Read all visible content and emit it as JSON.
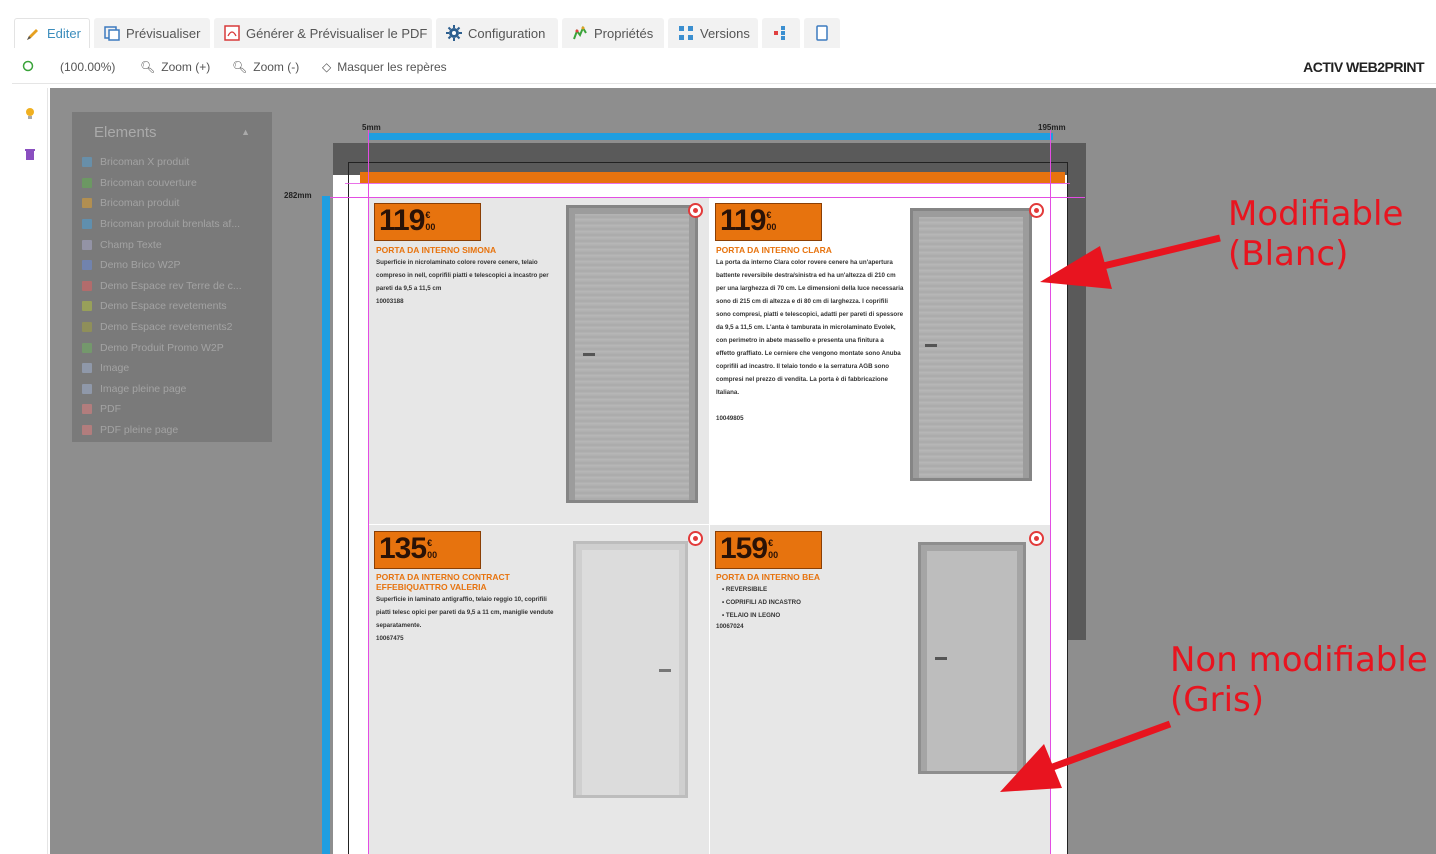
{
  "tabs": [
    {
      "label": "Editer",
      "icon": "pencil-icon",
      "active": true
    },
    {
      "label": "Prévisualiser",
      "icon": "preview-icon"
    },
    {
      "label": "Générer & Prévisualiser le PDF",
      "icon": "pdf-icon"
    },
    {
      "label": "Configuration",
      "icon": "gear-icon"
    },
    {
      "label": "Propriétés",
      "icon": "properties-icon"
    },
    {
      "label": "Versions",
      "icon": "versions-icon"
    },
    {
      "label": "",
      "icon": "layout-icon"
    },
    {
      "label": "",
      "icon": "page-icon"
    }
  ],
  "toolbar": {
    "zoom_level": "(100.00%)",
    "zoom_in": "Zoom (+)",
    "zoom_out": "Zoom (-)",
    "hide_guides": "Masquer les repères",
    "brand": "ACTIV WEB2PRINT"
  },
  "elements_panel": {
    "title": "Elements",
    "items": [
      {
        "label": "Bricoman X produit",
        "color": "#5aa0d0"
      },
      {
        "label": "Bricoman couverture",
        "color": "#60b050"
      },
      {
        "label": "Bricoman produit",
        "color": "#e0a030"
      },
      {
        "label": "Bricoman produit brenlats af...",
        "color": "#4aa0d8"
      },
      {
        "label": "Champ Texte",
        "color": "#a8a8c8"
      },
      {
        "label": "Demo Brico W2P",
        "color": "#6a8ad8"
      },
      {
        "label": "Demo Espace rev Terre de c...",
        "color": "#e06060"
      },
      {
        "label": "Demo Espace revetements",
        "color": "#b0c040"
      },
      {
        "label": "Demo Espace revetements2",
        "color": "#a0a040"
      },
      {
        "label": "Demo Produit Promo W2P",
        "color": "#70b060"
      },
      {
        "label": "Image",
        "color": "#a0b0d0"
      },
      {
        "label": "Image pleine page",
        "color": "#a0b0d0"
      },
      {
        "label": "PDF",
        "color": "#e08080"
      },
      {
        "label": "PDF pleine page",
        "color": "#e08080"
      }
    ]
  },
  "rulers": {
    "top_start": "5mm",
    "top_end": "195mm",
    "left": "282mm"
  },
  "products": [
    {
      "price_main": "119",
      "price_currency": "€",
      "price_cents": "00",
      "title": "PORTA DA INTERNO SIMONA",
      "desc": "Superficie in nicrolaminato colore rovere cenere, telaio compreso in nell, coprifili piatti e telescopici a incastro per pareti da 9,5 a 11,5 cm",
      "ref": "10003188"
    },
    {
      "price_main": "119",
      "price_currency": "€",
      "price_cents": "00",
      "title": "PORTA DA INTERNO CLARA",
      "desc": "La porta da interno Clara color rovere cenere ha un'apertura battente reversibile destra/sinistra ed ha un'altezza di 210 cm per una larghezza di 70 cm. Le dimensioni della luce necessaria sono di 215 cm di altezza e di 80 cm di larghezza. I coprifili sono compresi, piatti e telescopici, adatti per pareti di spessore da 9,5 a 11,5 cm. L'anta è tamburata in microlaminato Evolek, con perimetro in abete massello e presenta una finitura a effetto graffiato. Le cerniere che vengono montate sono Anuba coprifili ad incastro. Il telaio tondo e la serratura AGB sono compresi nel prezzo di vendita. La porta è di fabbricazione Italiana.",
      "ref": "10049805"
    },
    {
      "price_main": "135",
      "price_currency": "€",
      "price_cents": "00",
      "title": "PORTA DA INTERNO CONTRACT EFFEBIQUATTRO VALERIA",
      "desc": "Superficie in laminato antigraffio, telaio reggio 10, coprifili piatti telesc opici per pareti da 9,5 a 11 cm, maniglie vendute separatamente.",
      "ref": "10067475"
    },
    {
      "price_main": "159",
      "price_currency": "€",
      "price_cents": "00",
      "title": "PORTA DA INTERNO BEA",
      "bullets": [
        "REVERSIBILE",
        "COPRIFILI AD INCASTRO",
        "TELAIO IN LEGNO"
      ],
      "ref": "10067024"
    }
  ],
  "annotations": {
    "modifiable": [
      "Modifiable",
      "(Blanc)"
    ],
    "non_modifiable": [
      "Non modifiable",
      "(Gris)"
    ],
    "color": "#e8141f"
  },
  "colors": {
    "accent": "#e7730e",
    "guide_blue": "#1f9ee0",
    "guide_pink": "#e34de3"
  }
}
